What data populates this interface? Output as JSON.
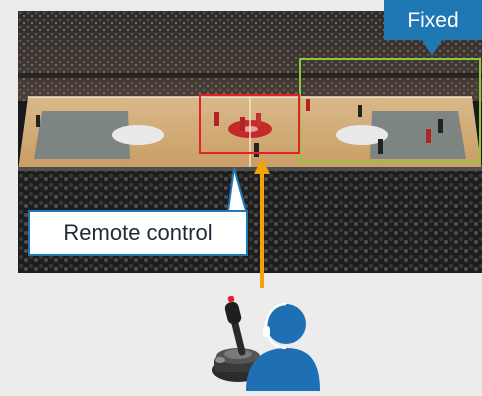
{
  "labels": {
    "fixed": "Fixed",
    "remote_control": "Remote control"
  },
  "colors": {
    "fixed_box": "#8dc63f",
    "remote_box": "#e3212b",
    "callout_blue": "#1f78b4",
    "arrow_orange": "#f0a30a",
    "operator_blue": "#1f6fb4"
  },
  "icons": {
    "joystick": "joystick-icon",
    "operator": "operator-headset-icon"
  }
}
